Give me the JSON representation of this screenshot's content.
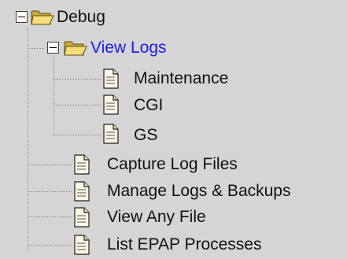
{
  "tree": {
    "root": {
      "label": "Debug",
      "icon": "folder-open-icon",
      "toggle": "collapse",
      "children": {
        "view_logs": {
          "label": "View Logs",
          "icon": "folder-open-icon",
          "toggle": "collapse",
          "selected_color": "#1a1aee",
          "children": [
            {
              "label": "Maintenance",
              "icon": "document-icon"
            },
            {
              "label": "CGI",
              "icon": "document-icon"
            },
            {
              "label": "GS",
              "icon": "document-icon"
            }
          ]
        },
        "items": [
          {
            "label": "Capture Log Files",
            "icon": "document-icon"
          },
          {
            "label": "Manage Logs & Backups",
            "icon": "document-icon"
          },
          {
            "label": "View Any File",
            "icon": "document-icon"
          },
          {
            "label": "List EPAP Processes",
            "icon": "document-icon"
          }
        ]
      }
    }
  },
  "colors": {
    "background": "#d5d5d5",
    "folder": "#f5d76e",
    "link": "#1a1aee",
    "text": "#111111"
  }
}
